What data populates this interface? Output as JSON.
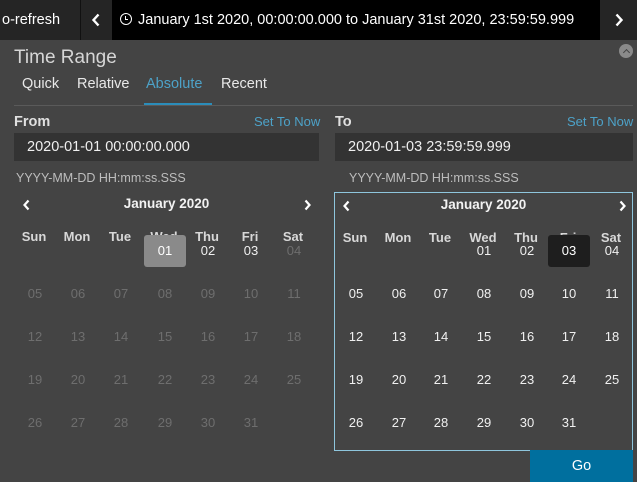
{
  "topbar": {
    "auto_refresh_label": "o-refresh",
    "time_range_text": "January 1st 2020, 00:00:00.000 to January 31st 2020, 23:59:59.999"
  },
  "panel": {
    "title": "Time Range",
    "tabs": [
      {
        "label": "Quick",
        "active": false
      },
      {
        "label": "Relative",
        "active": false
      },
      {
        "label": "Absolute",
        "active": true
      },
      {
        "label": "Recent",
        "active": false
      }
    ]
  },
  "from": {
    "title": "From",
    "set_to_now": "Set To Now",
    "value": "2020-01-01 00:00:00.000",
    "format_hint": "YYYY-MM-DD HH:mm:ss.SSS",
    "calendar": {
      "month": "January 2020",
      "weekdays": [
        "Sun",
        "Mon",
        "Tue",
        "Wed",
        "Thu",
        "Fri",
        "Sat"
      ],
      "weeks": [
        [
          "",
          "",
          "",
          "01",
          "02",
          "03",
          "04"
        ],
        [
          "05",
          "06",
          "07",
          "08",
          "09",
          "10",
          "11"
        ],
        [
          "12",
          "13",
          "14",
          "15",
          "16",
          "17",
          "18"
        ],
        [
          "19",
          "20",
          "21",
          "22",
          "23",
          "24",
          "25"
        ],
        [
          "26",
          "27",
          "28",
          "29",
          "30",
          "31",
          ""
        ]
      ],
      "selected": "01"
    }
  },
  "to": {
    "title": "To",
    "set_to_now": "Set To Now",
    "value": "2020-01-03 23:59:59.999",
    "format_hint": "YYYY-MM-DD HH:mm:ss.SSS",
    "calendar": {
      "month": "January 2020",
      "weekdays": [
        "Sun",
        "Mon",
        "Tue",
        "Wed",
        "Thu",
        "Fri",
        "Sat"
      ],
      "weeks": [
        [
          "",
          "",
          "",
          "01",
          "02",
          "03",
          "04"
        ],
        [
          "05",
          "06",
          "07",
          "08",
          "09",
          "10",
          "11"
        ],
        [
          "12",
          "13",
          "14",
          "15",
          "16",
          "17",
          "18"
        ],
        [
          "19",
          "20",
          "21",
          "22",
          "23",
          "24",
          "25"
        ],
        [
          "26",
          "27",
          "28",
          "29",
          "30",
          "31",
          ""
        ]
      ],
      "selected": "03"
    }
  },
  "actions": {
    "go_label": "Go"
  },
  "colors": {
    "accent": "#4da2c8",
    "go_button": "#006f9e",
    "panel_bg": "#444444",
    "topbar_bg": "#252525"
  },
  "icons": {
    "prev": "chevron-left-icon",
    "next": "chevron-right-icon",
    "clock": "clock-icon",
    "collapse": "chevron-up-icon"
  }
}
